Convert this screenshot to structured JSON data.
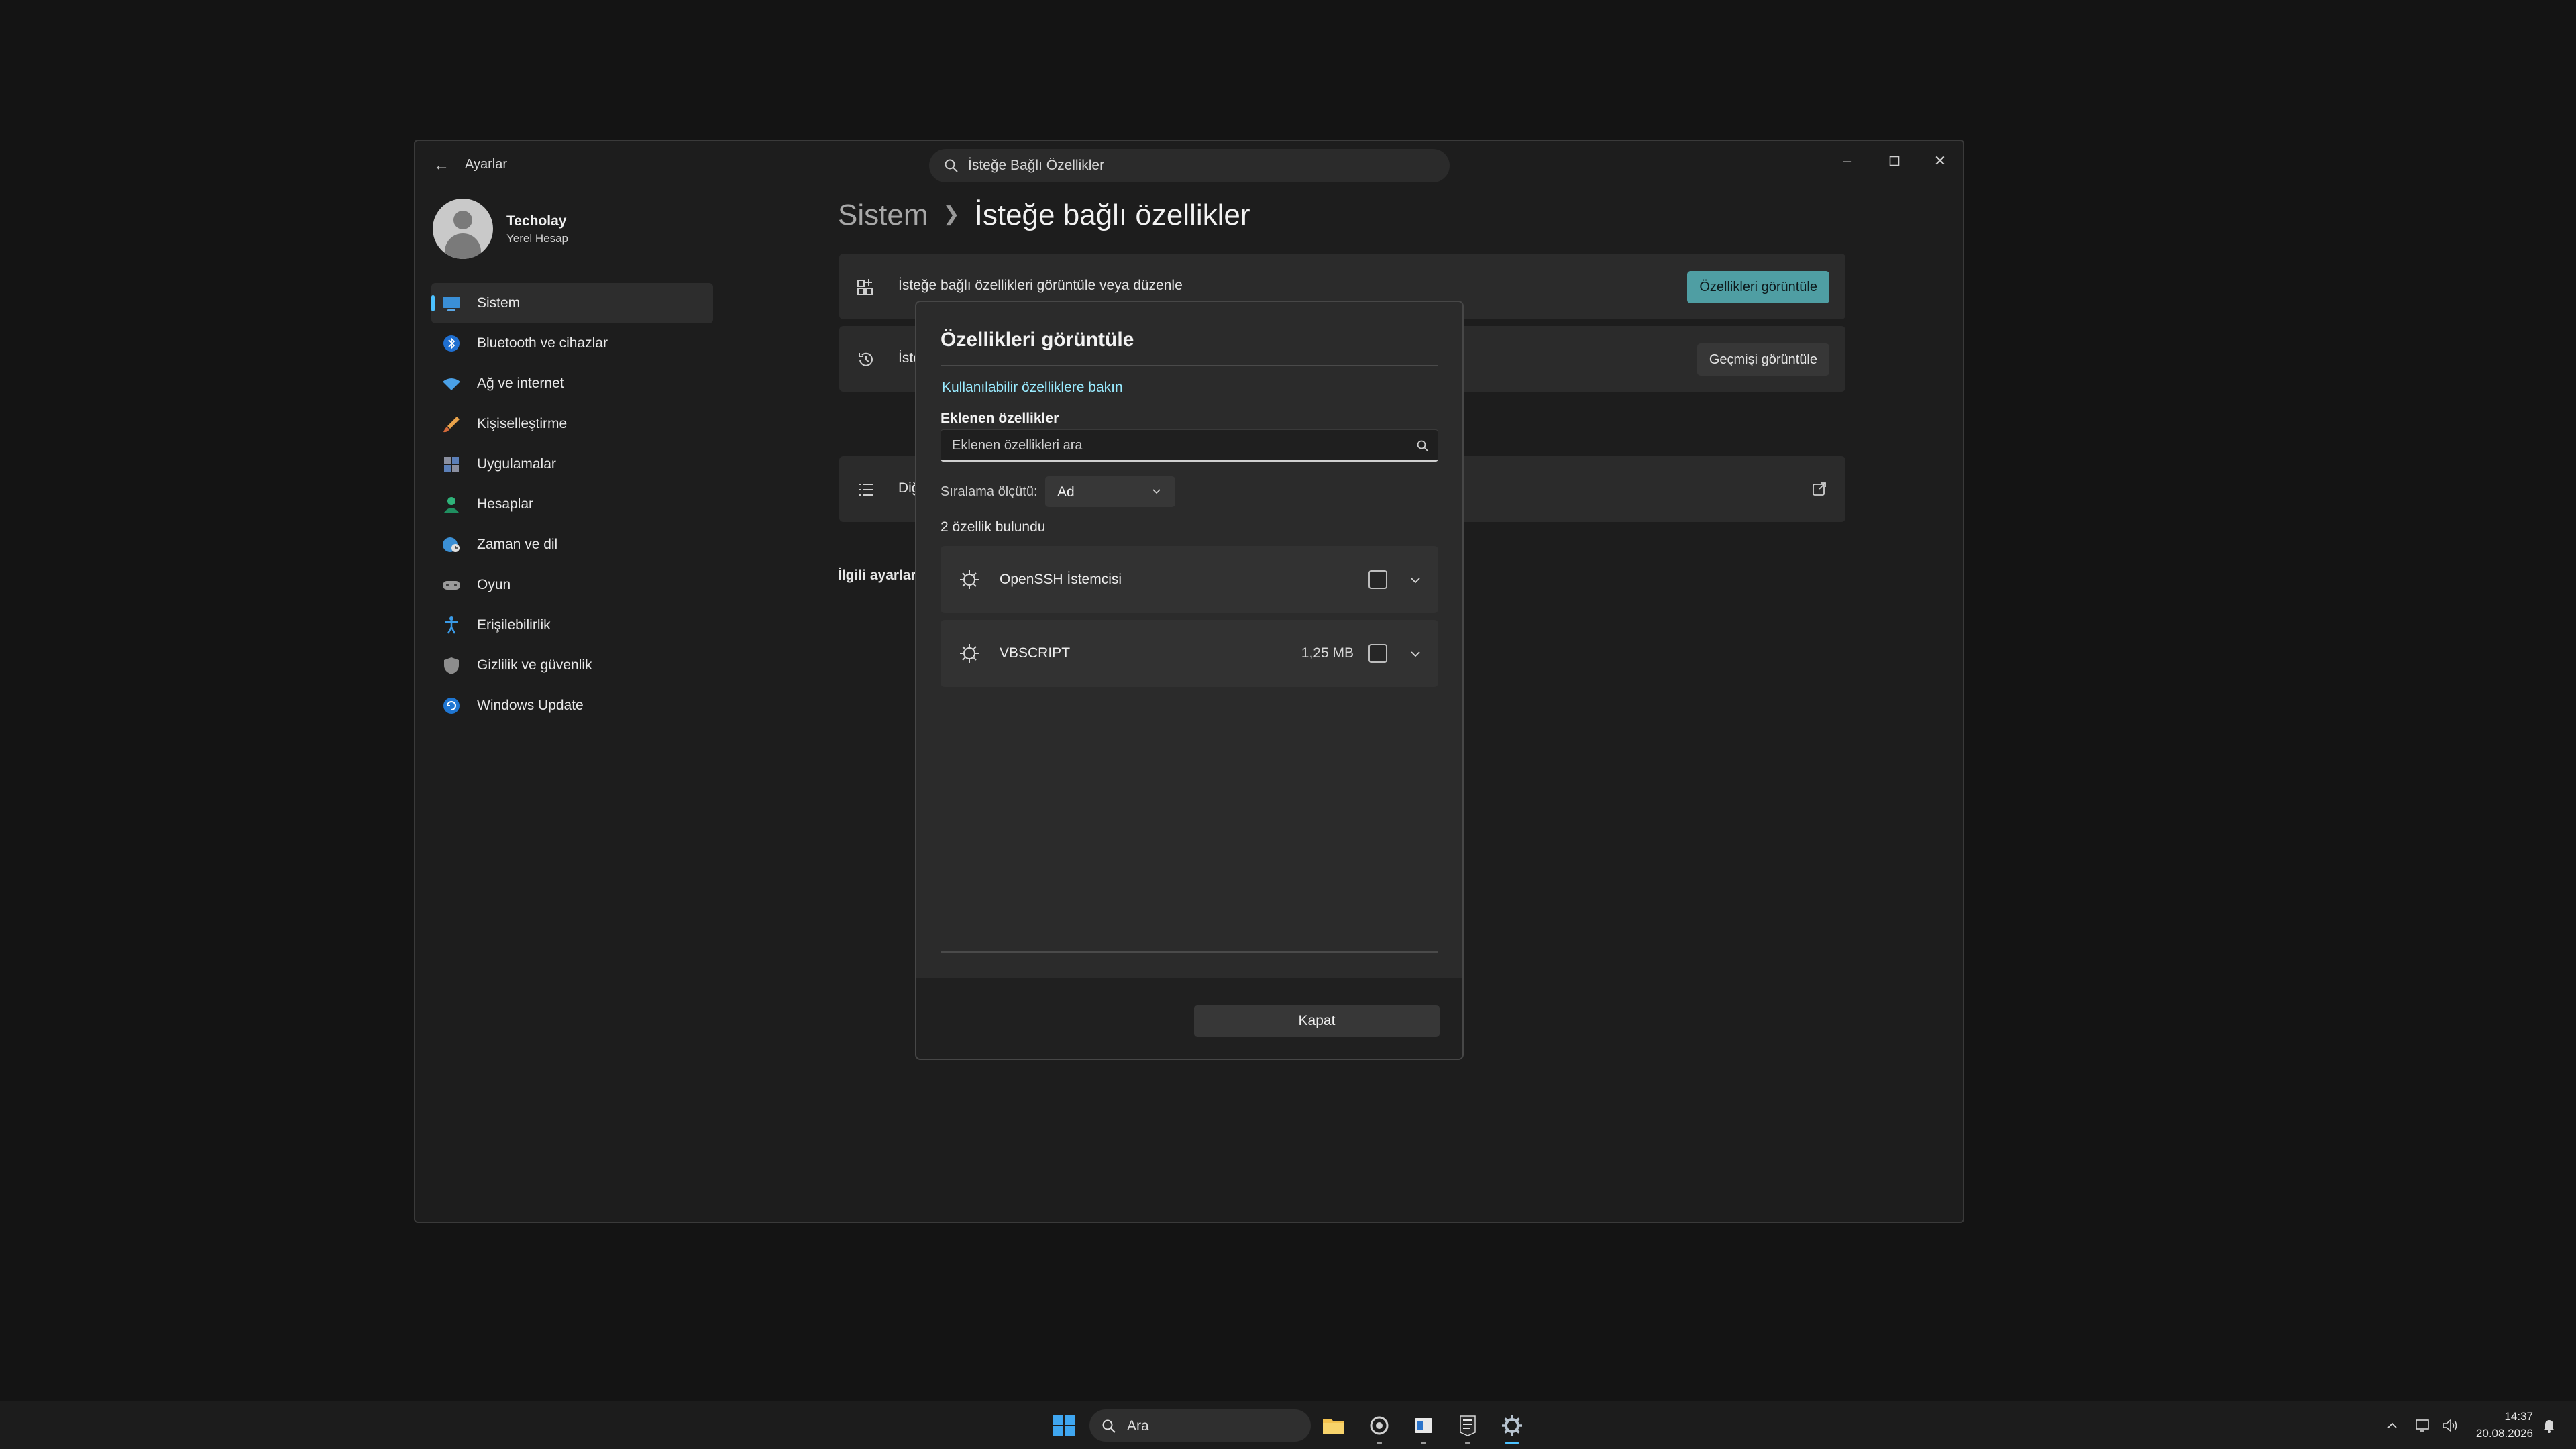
{
  "window": {
    "title": "Ayarlar",
    "search_value": "İsteğe Bağlı Özellikler"
  },
  "profile": {
    "name": "Techolay",
    "account_type": "Yerel Hesap"
  },
  "sidebar": {
    "items": [
      {
        "label": "Sistem",
        "icon": "system-icon",
        "active": true
      },
      {
        "label": "Bluetooth ve cihazlar",
        "icon": "bluetooth-icon"
      },
      {
        "label": "Ağ ve internet",
        "icon": "wifi-icon"
      },
      {
        "label": "Kişiselleştirme",
        "icon": "brush-icon"
      },
      {
        "label": "Uygulamalar",
        "icon": "apps-icon"
      },
      {
        "label": "Hesaplar",
        "icon": "account-icon"
      },
      {
        "label": "Zaman ve dil",
        "icon": "globe-clock-icon"
      },
      {
        "label": "Oyun",
        "icon": "gamepad-icon"
      },
      {
        "label": "Erişilebilirlik",
        "icon": "accessibility-icon"
      },
      {
        "label": "Gizlilik ve güvenlik",
        "icon": "shield-icon"
      },
      {
        "label": "Windows Update",
        "icon": "update-icon"
      }
    ]
  },
  "breadcrumb": {
    "parent": "Sistem",
    "current": "İsteğe bağlı özellikler"
  },
  "cards": {
    "view_edit": {
      "label": "İsteğe bağlı özellikleri görüntüle veya düzenle",
      "button": "Özellikleri görüntüle"
    },
    "history": {
      "label": "İste",
      "button": "Geçmişi görüntüle"
    },
    "related_heading": "İlgili ayarlar",
    "related_item": "Diğ"
  },
  "dialog": {
    "title": "Özellikleri görüntüle",
    "link": "Kullanılabilir özelliklere bakın",
    "installed_label": "Eklenen özellikler",
    "search_placeholder": "Eklenen özellikleri ara",
    "sort_label": "Sıralama ölçütü:",
    "sort_value": "Ad",
    "count_text": "2 özellik bulundu",
    "features": [
      {
        "name": "OpenSSH İstemcisi",
        "size": "",
        "checked": false
      },
      {
        "name": "VBSCRIPT",
        "size": "1,25 MB",
        "checked": false
      }
    ],
    "close_button": "Kapat"
  },
  "taskbar": {
    "search_value": "Ara",
    "time": "14:37",
    "date": "20.08.2026"
  },
  "colors": {
    "accent": "#4f9ea3",
    "link": "#99ebff",
    "nav_indicator": "#4cc2ff"
  }
}
